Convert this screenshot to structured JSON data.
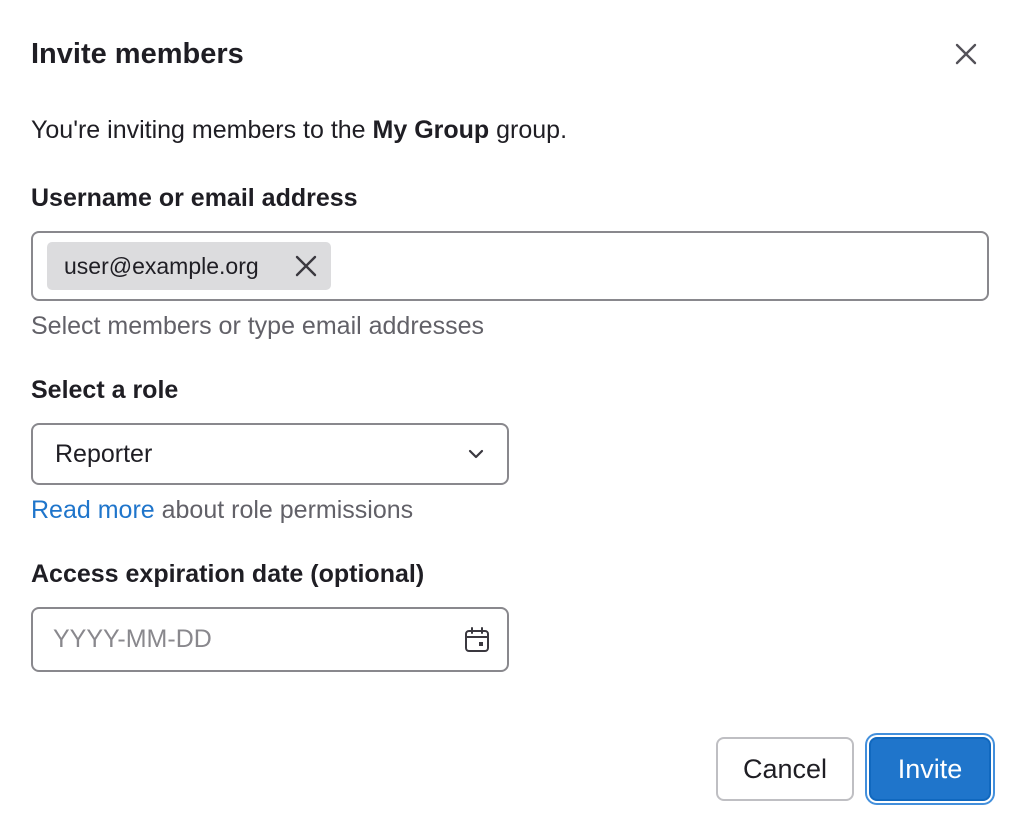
{
  "modal": {
    "title": "Invite members",
    "close_label": "×"
  },
  "intro": {
    "prefix": "You're inviting members to the ",
    "group_name": "My Group",
    "suffix": " group."
  },
  "members_field": {
    "label": "Username or email address",
    "tokens": [
      "user@example.org"
    ],
    "help_text": "Select members or type email addresses"
  },
  "role_field": {
    "label": "Select a role",
    "selected_value": "Reporter",
    "help_link": "Read more",
    "help_suffix": " about role permissions"
  },
  "expiration_field": {
    "label": "Access expiration date (optional)",
    "value": "",
    "placeholder": "YYYY-MM-DD"
  },
  "footer": {
    "cancel_label": "Cancel",
    "invite_label": "Invite"
  },
  "colors": {
    "primary": "#1f75cb",
    "border": "#89888d",
    "token_bg": "#dcdcde",
    "muted_text": "#626168"
  }
}
